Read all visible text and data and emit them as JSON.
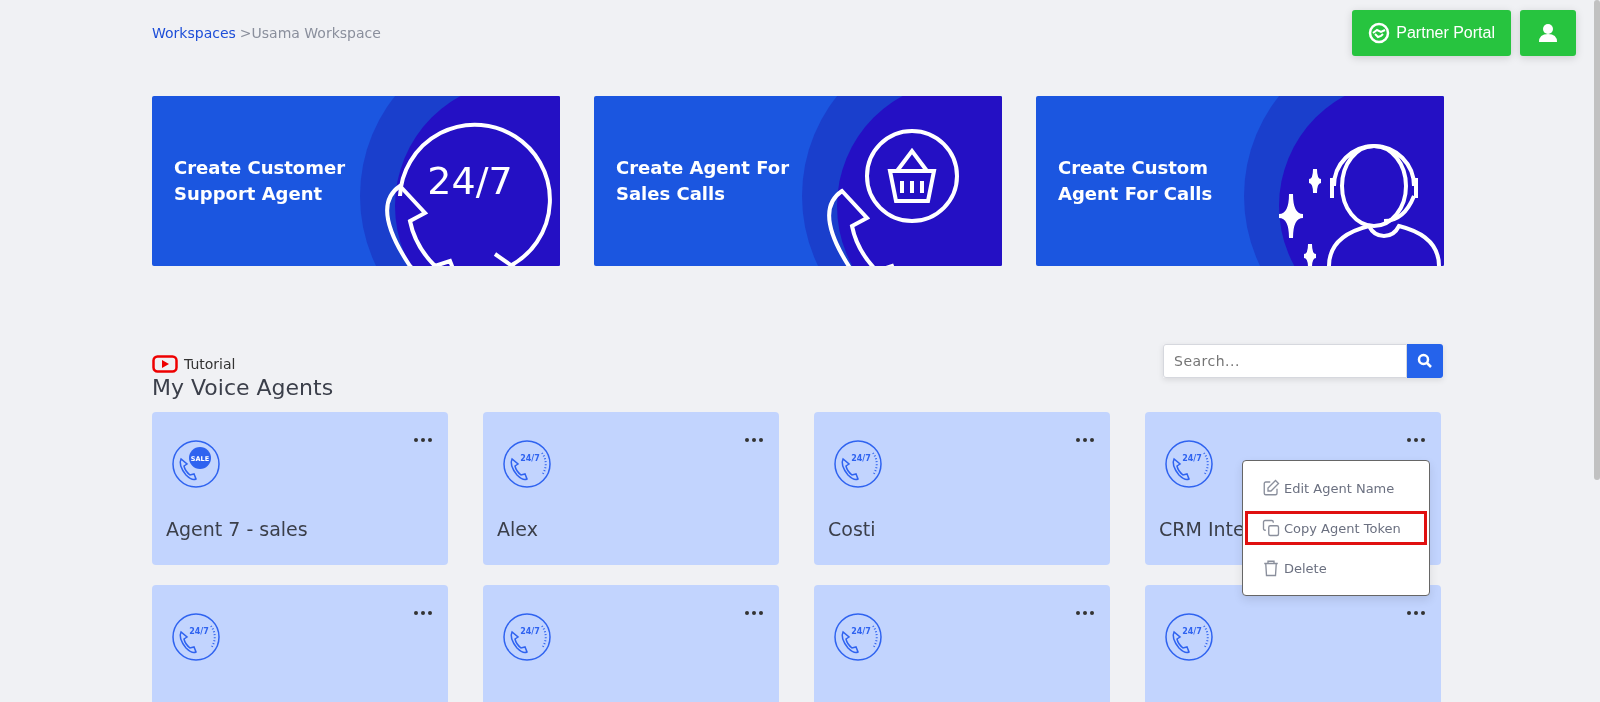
{
  "breadcrumb": {
    "link": "Workspaces",
    "current": ">Usama Workspace"
  },
  "header_buttons": {
    "partner_portal": "Partner Portal"
  },
  "banners": [
    {
      "title": "Create Customer Support Agent",
      "kind": "clock",
      "art_text": "24/7"
    },
    {
      "title": "Create Agent For Sales Calls",
      "kind": "basket"
    },
    {
      "title": "Create Custom Agent For Calls",
      "kind": "headset"
    }
  ],
  "tutorial_link": "Tutorial",
  "heading": "My Voice Agents",
  "search": {
    "placeholder": "Search..."
  },
  "agents": [
    {
      "name": "Agent 7 - sales",
      "icon_text": "SALE",
      "kind": "sale",
      "menu_open": false
    },
    {
      "name": "Alex",
      "icon_text": "24/7",
      "kind": "clock",
      "menu_open": false
    },
    {
      "name": "Costi",
      "icon_text": "24/7",
      "kind": "clock",
      "menu_open": false
    },
    {
      "name": "CRM Inte",
      "icon_text": "24/7",
      "kind": "clock",
      "menu_open": true
    },
    {
      "icon_text": "24/7",
      "kind": "clock",
      "menu_open": false
    },
    {
      "icon_text": "24/7",
      "kind": "clock",
      "menu_open": false
    },
    {
      "icon_text": "24/7",
      "kind": "clock",
      "menu_open": false
    },
    {
      "icon_text": "24/7",
      "kind": "clock",
      "menu_open": false
    }
  ],
  "context_menu": [
    {
      "label": "Edit Agent Name",
      "kind": "edit",
      "selected": false
    },
    {
      "label": "Copy Agent Token",
      "kind": "copy",
      "selected": true
    },
    {
      "label": "Delete",
      "kind": "delete",
      "selected": false
    }
  ]
}
